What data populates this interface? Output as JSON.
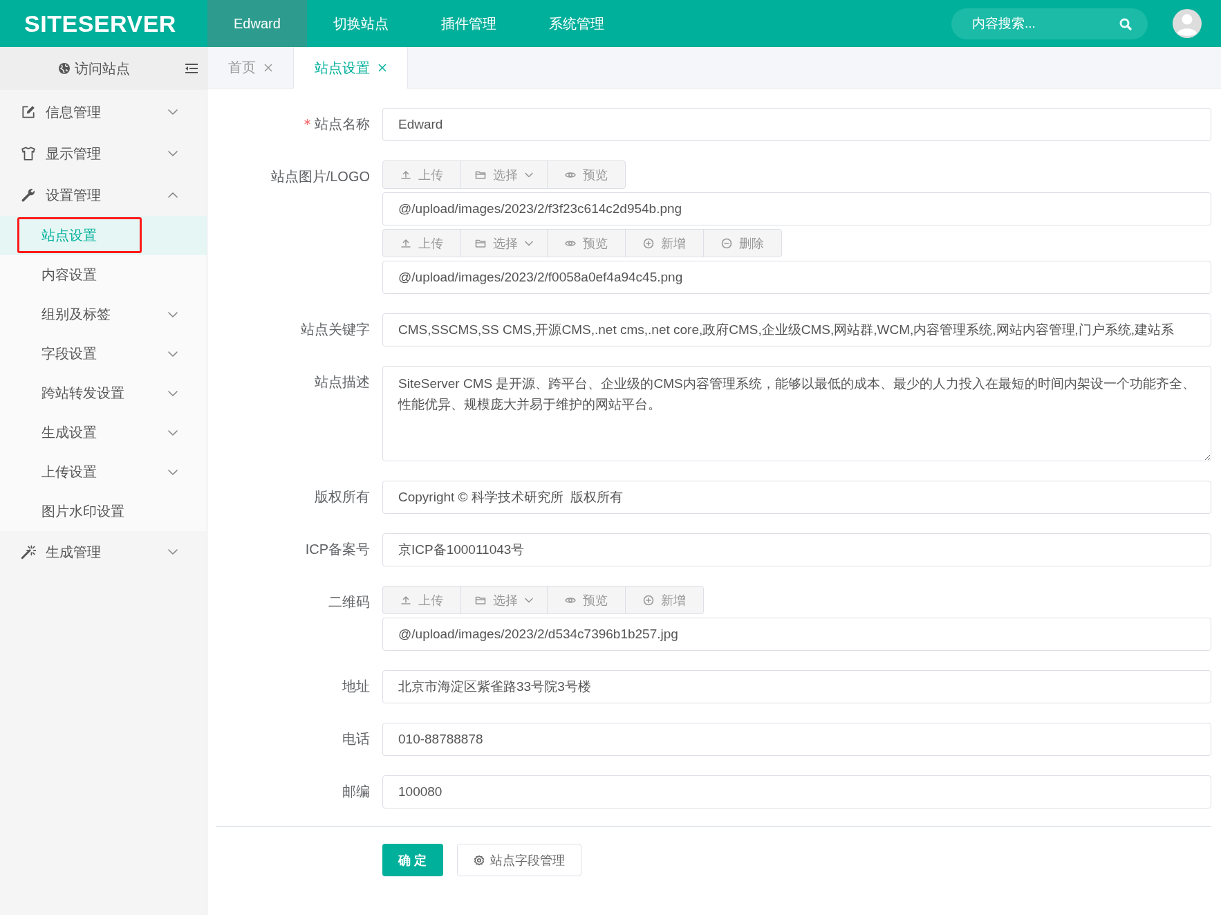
{
  "header": {
    "logo": "SITESERVER",
    "nav": [
      {
        "label": "Edward",
        "selected": true
      },
      {
        "label": "切换站点",
        "selected": false
      },
      {
        "label": "插件管理",
        "selected": false
      },
      {
        "label": "系统管理",
        "selected": false
      }
    ],
    "search": {
      "placeholder": "内容搜索..."
    }
  },
  "sidebar": {
    "visit_link": "访问站点",
    "groups": [
      {
        "label": "信息管理",
        "expanded": false
      },
      {
        "label": "显示管理",
        "expanded": false
      },
      {
        "label": "设置管理",
        "expanded": true,
        "children": [
          {
            "label": "站点设置",
            "kind": "link",
            "selected": true,
            "highlighted": true
          },
          {
            "label": "内容设置",
            "kind": "link",
            "selected": false,
            "highlighted": false
          },
          {
            "label": "组别及标签",
            "kind": "submenu",
            "selected": false,
            "highlighted": false,
            "expanded": false
          },
          {
            "label": "字段设置",
            "kind": "submenu",
            "selected": false,
            "highlighted": false,
            "expanded": false
          },
          {
            "label": "跨站转发设置",
            "kind": "submenu",
            "selected": false,
            "highlighted": false,
            "expanded": false
          },
          {
            "label": "生成设置",
            "kind": "submenu",
            "selected": false,
            "highlighted": false,
            "expanded": false
          },
          {
            "label": "上传设置",
            "kind": "submenu",
            "selected": false,
            "highlighted": false,
            "expanded": false
          },
          {
            "label": "图片水印设置",
            "kind": "link",
            "selected": false,
            "highlighted": false
          }
        ]
      },
      {
        "label": "生成管理",
        "expanded": false
      }
    ]
  },
  "tabs": [
    {
      "label": "首页",
      "selected": false
    },
    {
      "label": "站点设置",
      "selected": true
    }
  ],
  "form": {
    "rows": [
      {
        "label": "站点名称",
        "required": true,
        "kind": "input",
        "value": "Edward"
      },
      {
        "label": "站点图片/LOGO",
        "required": false,
        "kind": "upload",
        "groups": [
          {
            "buttons": [
              {
                "label": "上传",
                "kind": "upload"
              },
              {
                "label": "选择",
                "kind": "select"
              },
              {
                "label": "预览",
                "kind": "preview"
              }
            ],
            "value": "@/upload/images/2023/2/f3f23c614c2d954b.png"
          },
          {
            "buttons": [
              {
                "label": "上传",
                "kind": "upload"
              },
              {
                "label": "选择",
                "kind": "select"
              },
              {
                "label": "预览",
                "kind": "preview"
              },
              {
                "label": "新增",
                "kind": "add"
              },
              {
                "label": "删除",
                "kind": "delete"
              }
            ],
            "value": "@/upload/images/2023/2/f0058a0ef4a94c45.png"
          }
        ]
      },
      {
        "label": "站点关键字",
        "required": false,
        "kind": "input",
        "value": "CMS,SSCMS,SS CMS,开源CMS,.net cms,.net core,政府CMS,企业级CMS,网站群,WCM,内容管理系统,网站内容管理,门户系统,建站系"
      },
      {
        "label": "站点描述",
        "required": false,
        "kind": "textarea",
        "value": "SiteServer CMS 是开源、跨平台、企业级的CMS内容管理系统，能够以最低的成本、最少的人力投入在最短的时间内架设一个功能齐全、性能优异、规模庞大并易于维护的网站平台。"
      },
      {
        "label": "版权所有",
        "required": false,
        "kind": "input",
        "value": "Copyright © 科学技术研究所  版权所有"
      },
      {
        "label": "ICP备案号",
        "required": false,
        "kind": "input",
        "value": "京ICP备100011043号"
      },
      {
        "label": "二维码",
        "required": false,
        "kind": "upload",
        "groups": [
          {
            "buttons": [
              {
                "label": "上传",
                "kind": "upload"
              },
              {
                "label": "选择",
                "kind": "select"
              },
              {
                "label": "预览",
                "kind": "preview"
              },
              {
                "label": "新增",
                "kind": "add"
              }
            ],
            "value": "@/upload/images/2023/2/d534c7396b1b257.jpg"
          }
        ]
      },
      {
        "label": "地址",
        "required": false,
        "kind": "input",
        "value": "北京市海淀区紫雀路33号院3号楼"
      },
      {
        "label": "电话",
        "required": false,
        "kind": "input",
        "value": "010-88788878"
      },
      {
        "label": "邮编",
        "required": false,
        "kind": "input",
        "value": "100080"
      }
    ],
    "actions": [
      {
        "label": "确 定",
        "kind": "primary"
      },
      {
        "label": "站点字段管理",
        "kind": "secondary"
      }
    ]
  }
}
